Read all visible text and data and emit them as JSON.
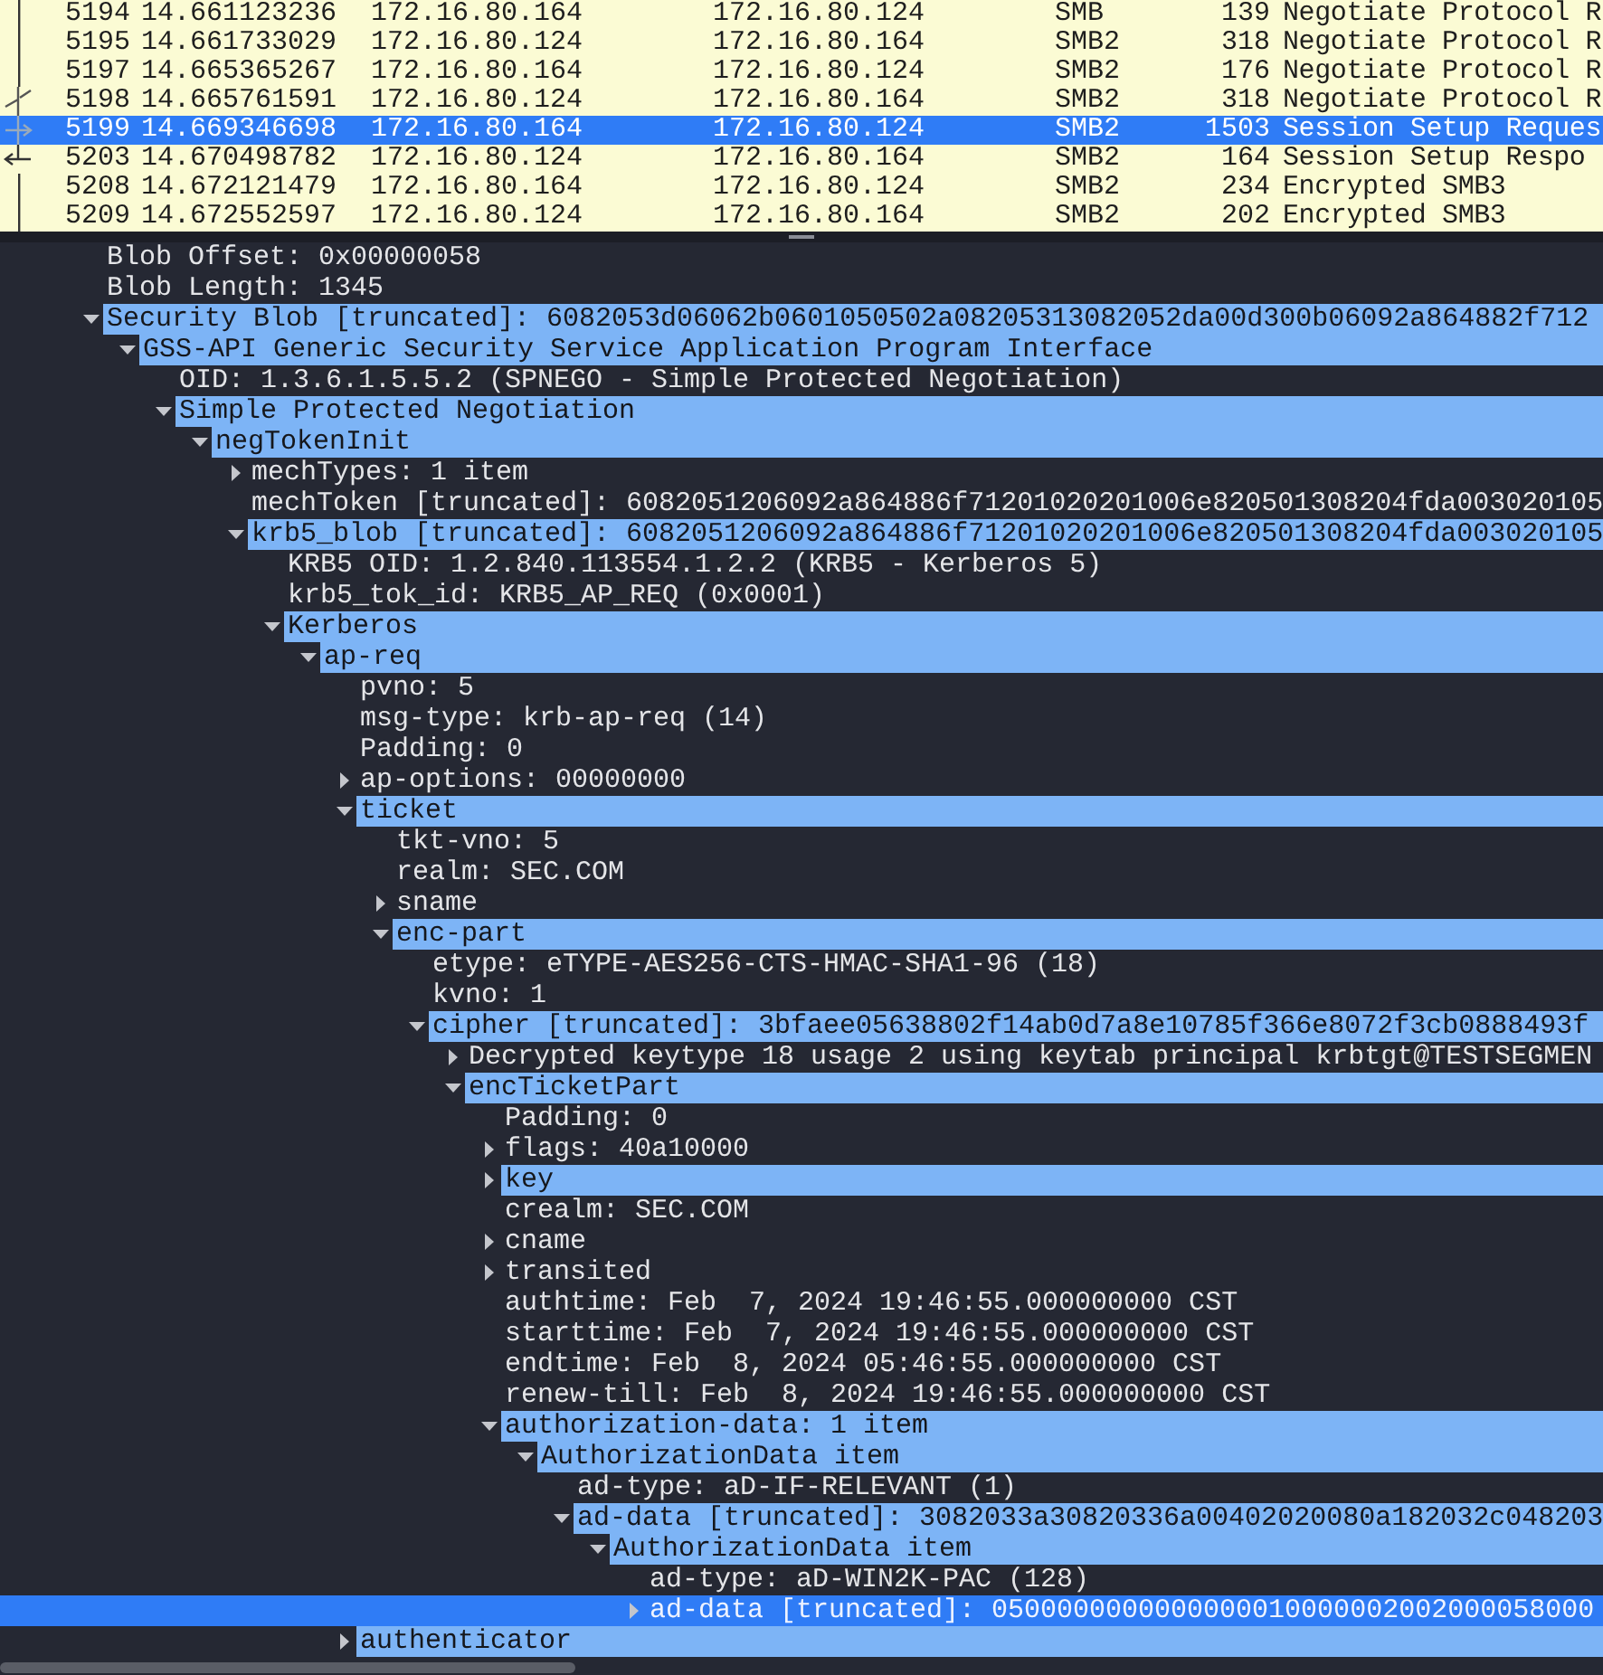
{
  "packet_list": {
    "rows": [
      {
        "no": "5194",
        "time": "14.661123236",
        "source": "172.16.80.164",
        "destination": "172.16.80.124",
        "protocol": "SMB",
        "length": "139",
        "info": "Negotiate Protocol R",
        "selected": false,
        "kind": "plain"
      },
      {
        "no": "5195",
        "time": "14.661733029",
        "source": "172.16.80.124",
        "destination": "172.16.80.164",
        "protocol": "SMB2",
        "length": "318",
        "info": "Negotiate Protocol R",
        "selected": false,
        "kind": "plain"
      },
      {
        "no": "5197",
        "time": "14.665365267",
        "source": "172.16.80.164",
        "destination": "172.16.80.124",
        "protocol": "SMB2",
        "length": "176",
        "info": "Negotiate Protocol R",
        "selected": false,
        "kind": "plain"
      },
      {
        "no": "5198",
        "time": "14.665761591",
        "source": "172.16.80.124",
        "destination": "172.16.80.164",
        "protocol": "SMB2",
        "length": "318",
        "info": "Negotiate Protocol R",
        "selected": false,
        "kind": "ack"
      },
      {
        "no": "5199",
        "time": "14.669346698",
        "source": "172.16.80.164",
        "destination": "172.16.80.124",
        "protocol": "SMB2",
        "length": "1503",
        "info": "Session Setup Reques",
        "selected": true,
        "kind": "request"
      },
      {
        "no": "5203",
        "time": "14.670498782",
        "source": "172.16.80.124",
        "destination": "172.16.80.164",
        "protocol": "SMB2",
        "length": "164",
        "info": "Session Setup Respo",
        "selected": false,
        "kind": "response"
      },
      {
        "no": "5208",
        "time": "14.672121479",
        "source": "172.16.80.164",
        "destination": "172.16.80.124",
        "protocol": "SMB2",
        "length": "234",
        "info": "Encrypted SMB3",
        "selected": false,
        "kind": "plain"
      },
      {
        "no": "5209",
        "time": "14.672552597",
        "source": "172.16.80.124",
        "destination": "172.16.80.164",
        "protocol": "SMB2",
        "length": "202",
        "info": "Encrypted SMB3",
        "selected": false,
        "kind": "plain"
      }
    ]
  },
  "details": [
    {
      "text": "Blob Offset: 0x00000058",
      "highlighted": false,
      "selected": false
    },
    {
      "text": "Blob Length: 1345",
      "highlighted": false,
      "selected": false
    },
    {
      "text": "Security Blob [truncated]: 6082053d06062b0601050502a08205313082052da00d300b06092a864882f712",
      "highlighted": true,
      "selected": false,
      "expanded": true,
      "children": [
        {
          "text": "GSS-API Generic Security Service Application Program Interface",
          "highlighted": true,
          "selected": false,
          "expanded": true,
          "children": [
            {
              "text": "OID: 1.3.6.1.5.5.2 (SPNEGO - Simple Protected Negotiation)",
              "highlighted": false,
              "selected": false
            },
            {
              "text": "Simple Protected Negotiation",
              "highlighted": true,
              "selected": false,
              "expanded": true,
              "children": [
                {
                  "text": "negTokenInit",
                  "highlighted": true,
                  "selected": false,
                  "expanded": true,
                  "children": [
                    {
                      "text": "mechTypes: 1 item",
                      "highlighted": false,
                      "selected": false,
                      "expanded": false
                    },
                    {
                      "text": "mechToken [truncated]: 6082051206092a864886f71201020201006e820501308204fda003020105",
                      "highlighted": false,
                      "selected": false
                    },
                    {
                      "text": "krb5_blob [truncated]: 6082051206092a864886f71201020201006e820501308204fda003020105",
                      "highlighted": true,
                      "selected": false,
                      "expanded": true,
                      "children": [
                        {
                          "text": "KRB5 OID: 1.2.840.113554.1.2.2 (KRB5 - Kerberos 5)",
                          "highlighted": false,
                          "selected": false
                        },
                        {
                          "text": "krb5_tok_id: KRB5_AP_REQ (0x0001)",
                          "highlighted": false,
                          "selected": false
                        },
                        {
                          "text": "Kerberos",
                          "highlighted": true,
                          "selected": false,
                          "expanded": true,
                          "children": [
                            {
                              "text": "ap-req",
                              "highlighted": true,
                              "selected": false,
                              "expanded": true,
                              "children": [
                                {
                                  "text": "pvno: 5",
                                  "highlighted": false,
                                  "selected": false
                                },
                                {
                                  "text": "msg-type: krb-ap-req (14)",
                                  "highlighted": false,
                                  "selected": false
                                },
                                {
                                  "text": "Padding: 0",
                                  "highlighted": false,
                                  "selected": false
                                },
                                {
                                  "text": "ap-options: 00000000",
                                  "highlighted": false,
                                  "selected": false,
                                  "expanded": false
                                },
                                {
                                  "text": "ticket",
                                  "highlighted": true,
                                  "selected": false,
                                  "expanded": true,
                                  "children": [
                                    {
                                      "text": "tkt-vno: 5",
                                      "highlighted": false,
                                      "selected": false
                                    },
                                    {
                                      "text": "realm: SEC.COM",
                                      "highlighted": false,
                                      "selected": false
                                    },
                                    {
                                      "text": "sname",
                                      "highlighted": false,
                                      "selected": false,
                                      "expanded": false
                                    },
                                    {
                                      "text": "enc-part",
                                      "highlighted": true,
                                      "selected": false,
                                      "expanded": true,
                                      "children": [
                                        {
                                          "text": "etype: eTYPE-AES256-CTS-HMAC-SHA1-96 (18)",
                                          "highlighted": false,
                                          "selected": false
                                        },
                                        {
                                          "text": "kvno: 1",
                                          "highlighted": false,
                                          "selected": false
                                        },
                                        {
                                          "text": "cipher [truncated]: 3bfaee05638802f14ab0d7a8e10785f366e8072f3cb0888493f",
                                          "highlighted": true,
                                          "selected": false,
                                          "expanded": true,
                                          "children": [
                                            {
                                              "text": "Decrypted keytype 18 usage 2 using keytab principal krbtgt@TESTSEGMEN",
                                              "highlighted": false,
                                              "selected": false,
                                              "expanded": false
                                            },
                                            {
                                              "text": "encTicketPart",
                                              "highlighted": true,
                                              "selected": false,
                                              "expanded": true,
                                              "children": [
                                                {
                                                  "text": "Padding: 0",
                                                  "highlighted": false,
                                                  "selected": false
                                                },
                                                {
                                                  "text": "flags: 40a10000",
                                                  "highlighted": false,
                                                  "selected": false,
                                                  "expanded": false
                                                },
                                                {
                                                  "text": "key",
                                                  "highlighted": true,
                                                  "selected": false,
                                                  "expanded": false
                                                },
                                                {
                                                  "text": "crealm: SEC.COM",
                                                  "highlighted": false,
                                                  "selected": false
                                                },
                                                {
                                                  "text": "cname",
                                                  "highlighted": false,
                                                  "selected": false,
                                                  "expanded": false
                                                },
                                                {
                                                  "text": "transited",
                                                  "highlighted": false,
                                                  "selected": false,
                                                  "expanded": false
                                                },
                                                {
                                                  "text": "authtime: Feb  7, 2024 19:46:55.000000000 CST",
                                                  "highlighted": false,
                                                  "selected": false
                                                },
                                                {
                                                  "text": "starttime: Feb  7, 2024 19:46:55.000000000 CST",
                                                  "highlighted": false,
                                                  "selected": false
                                                },
                                                {
                                                  "text": "endtime: Feb  8, 2024 05:46:55.000000000 CST",
                                                  "highlighted": false,
                                                  "selected": false
                                                },
                                                {
                                                  "text": "renew-till: Feb  8, 2024 19:46:55.000000000 CST",
                                                  "highlighted": false,
                                                  "selected": false
                                                },
                                                {
                                                  "text": "authorization-data: 1 item",
                                                  "highlighted": true,
                                                  "selected": false,
                                                  "expanded": true,
                                                  "children": [
                                                    {
                                                      "text": "AuthorizationData item",
                                                      "highlighted": true,
                                                      "selected": false,
                                                      "expanded": true,
                                                      "children": [
                                                        {
                                                          "text": "ad-type: aD-IF-RELEVANT (1)",
                                                          "highlighted": false,
                                                          "selected": false
                                                        },
                                                        {
                                                          "text": "ad-data [truncated]: 3082033a30820336a00402020080a182032c048203",
                                                          "highlighted": true,
                                                          "selected": false,
                                                          "expanded": true,
                                                          "children": [
                                                            {
                                                              "text": "AuthorizationData item",
                                                              "highlighted": true,
                                                              "selected": false,
                                                              "expanded": true,
                                                              "children": [
                                                                {
                                                                  "text": "ad-type: aD-WIN2K-PAC (128)",
                                                                  "highlighted": false,
                                                                  "selected": false
                                                                },
                                                                {
                                                                  "text": "ad-data [truncated]: 0500000000000000010000002002000058000",
                                                                  "highlighted": false,
                                                                  "selected": true,
                                                                  "expanded": false
                                                                }
                                                              ]
                                                            }
                                                          ]
                                                        }
                                                      ]
                                                    }
                                                  ]
                                                }
                                              ]
                                            }
                                          ]
                                        }
                                      ]
                                    }
                                  ]
                                },
                                {
                                  "text": "authenticator",
                                  "highlighted": true,
                                  "selected": false,
                                  "expanded": false
                                }
                              ]
                            }
                          ]
                        }
                      ]
                    }
                  ]
                }
              ]
            }
          ]
        }
      ]
    }
  ]
}
